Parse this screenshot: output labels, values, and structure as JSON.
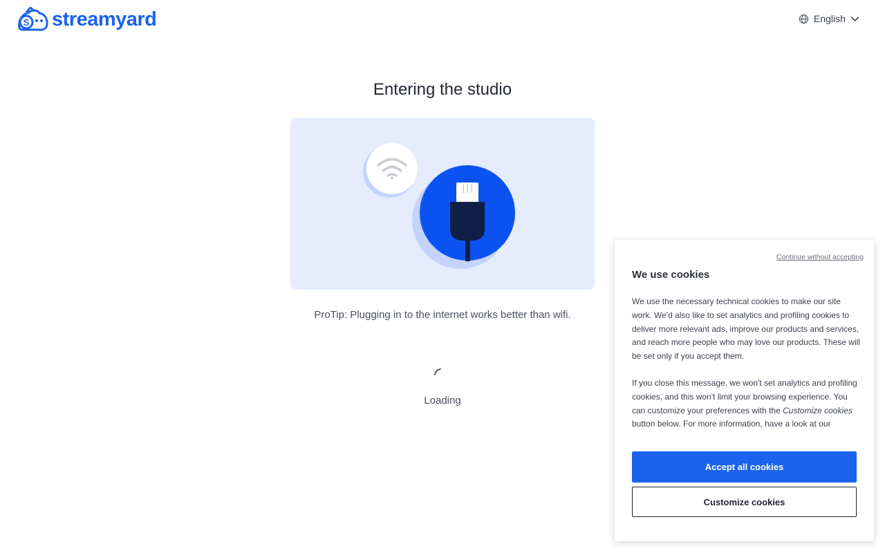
{
  "brand": {
    "name": "streamyard",
    "color": "#1b63ec"
  },
  "header": {
    "language": "English",
    "language_icon": "globe-icon",
    "dropdown_icon": "chevron-down-icon"
  },
  "main": {
    "title": "Entering the studio",
    "protip": "ProTip: Plugging in to the internet works better than wifi.",
    "loading": "Loading",
    "illustration": {
      "icons": [
        "wifi-icon",
        "ethernet-plug-icon"
      ],
      "background": "#e4ecfd",
      "accent": "#0c52f0"
    }
  },
  "cookie": {
    "continue_without": "Continue without accepting",
    "title": "We use cookies",
    "paragraph1": "We use the necessary technical cookies to make our site work. We'd also like to set analytics and profiling cookies to deliver more relevant ads, improve our products and services, and reach more people who may love our products. These will be set only if you accept them.",
    "paragraph2_before": "If you close this message, we won't set analytics and profiling cookies, and this won't limit your browsing experience. You can customize your preferences with the ",
    "paragraph2_emphasis": "Customize cookies",
    "paragraph2_after": " button below. For more information, have a look at our",
    "accept_label": "Accept all cookies",
    "customize_label": "Customize cookies"
  }
}
